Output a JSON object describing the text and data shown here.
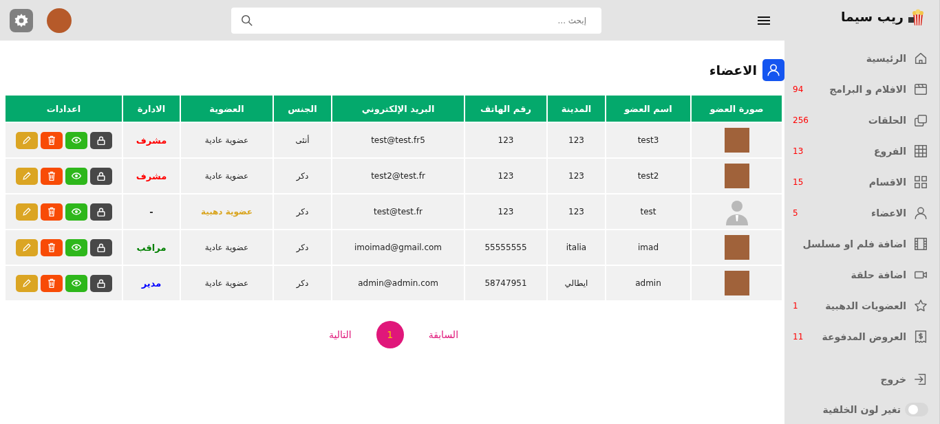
{
  "brand": {
    "name": "ريب سيما"
  },
  "sidebar": {
    "items": [
      {
        "label": "الرئيسية"
      },
      {
        "label": "الافلام و البرامج",
        "count": "94"
      },
      {
        "label": "الحلقات",
        "count": "256"
      },
      {
        "label": "الفروع",
        "count": "13"
      },
      {
        "label": "الاقسام",
        "count": "15"
      },
      {
        "label": "الاعضاء",
        "count": "5"
      },
      {
        "label": "اضافة فلم او مسلسل"
      },
      {
        "label": "اضافة حلقة"
      },
      {
        "label": "العضويات الدهبية",
        "count": "1"
      },
      {
        "label": "العروض المدفوعة",
        "count": "11"
      }
    ],
    "logout": "خروج",
    "theme_toggle": {
      "label": "تغير لون الخلفية",
      "on": false
    }
  },
  "search": {
    "placeholder": "إبحث ..."
  },
  "page_title": "الاعضاء",
  "table": {
    "columns": [
      "صورة العضو",
      "اسم العضو",
      "المدينة",
      "رقم الهاتف",
      "البريد الإلكتروني",
      "الجنس",
      "العضوية",
      "الادارة",
      "اعدادات"
    ],
    "rows": [
      {
        "kind": "image",
        "name": "test3",
        "city": "123",
        "phone": "123",
        "email": "test@test.fr5",
        "gender": "أنثى",
        "membership": {
          "text": "عضوية عادية",
          "gold": false
        },
        "role": {
          "text": "مشرف",
          "color": "#ff0000"
        }
      },
      {
        "kind": "image",
        "name": "test2",
        "city": "123",
        "phone": "123",
        "email": "test2@test.fr",
        "gender": "دكر",
        "membership": {
          "text": "عضوية عادية",
          "gold": false
        },
        "role": {
          "text": "مشرف",
          "color": "#ff0000"
        }
      },
      {
        "kind": "default",
        "name": "test",
        "city": "123",
        "phone": "123",
        "email": "test@test.fr",
        "gender": "دكر",
        "membership": {
          "text": "عضوية دهبية",
          "gold": true
        },
        "role": {
          "text": "-",
          "color": "#222222"
        }
      },
      {
        "kind": "image",
        "name": "imad",
        "city": "italia",
        "phone": "55555555",
        "email": "imoimad@gmail.com",
        "gender": "دكر",
        "membership": {
          "text": "عضوية عادية",
          "gold": false
        },
        "role": {
          "text": "مراقب",
          "color": "#008000"
        }
      },
      {
        "kind": "image",
        "name": "admin",
        "city": "ايطالي",
        "phone": "58747951",
        "email": "admin@admin.com",
        "gender": "دكر",
        "membership": {
          "text": "عضوية عادية",
          "gold": false
        },
        "role": {
          "text": "مدير",
          "color": "#0000ff"
        }
      }
    ]
  },
  "pagination": [
    {
      "label": "السابقة",
      "selected": false
    },
    {
      "label": "1",
      "selected": true
    },
    {
      "label": "التالية",
      "selected": false
    }
  ]
}
